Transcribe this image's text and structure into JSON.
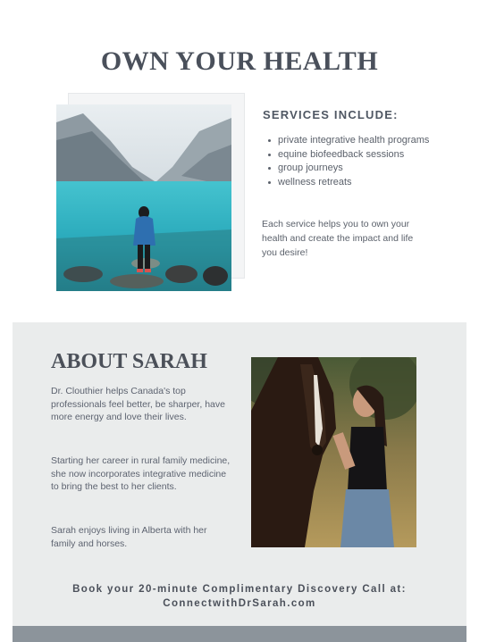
{
  "header": {
    "title": "OWN YOUR HEALTH"
  },
  "services": {
    "heading": "SERVICES INCLUDE:",
    "items": [
      "private integrative health programs",
      "equine biofeedback sessions",
      "group journeys",
      "wellness retreats"
    ],
    "paragraph": "Each service helps you to own your health and create the impact and life you desire!"
  },
  "about": {
    "title": "ABOUT SARAH",
    "paragraphs": [
      "Dr. Clouthier helps Canada's top professionals feel better, be sharper, have more energy and love their lives.",
      "Starting her career in rural family medicine, she now incorporates integrative medicine to bring the best to her clients.",
      "Sarah enjoys living in Alberta with her family and horses."
    ]
  },
  "cta": {
    "line1": "Book your 20-minute Complimentary Discovery Call at:",
    "line2": "ConnectwithDrSarah.com"
  },
  "colors": {
    "panel": "#eaecec",
    "footer_bar": "#8c949b",
    "lake": "#2fb3c4",
    "jacket": "#2e6fb0"
  }
}
